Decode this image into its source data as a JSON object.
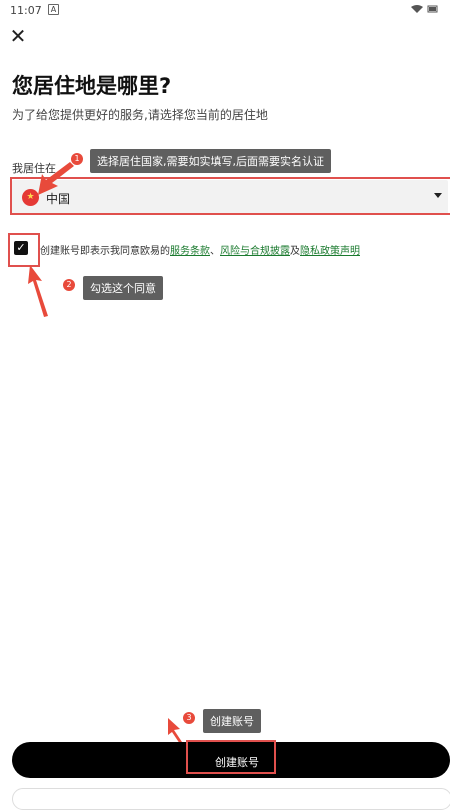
{
  "status_bar": {
    "time": "11:07",
    "sim_glyph": "A",
    "signal_icon": "wifi-icon",
    "battery_icon": "battery-icon"
  },
  "header": {
    "close_icon": "close-icon",
    "title": "您居住地是哪里?",
    "subtitle": "为了给您提供更好的服务,请选择您当前的居住地"
  },
  "form": {
    "country_label": "我居住在",
    "country_value": "中国",
    "flag_icon": "china-flag-icon",
    "agreement": {
      "checked": true,
      "prefix": "创建账号即表示我同意欧易的",
      "link1": "服务条款",
      "sep1": "、",
      "link2": "风险与合规披露",
      "sep2": "及",
      "link3": "隐私政策声明"
    },
    "create_button": "创建账号"
  },
  "annotations": {
    "tip1": {
      "number": "1",
      "text": "选择居住国家,需要如实填写,后面需要实名认证"
    },
    "tip2": {
      "number": "2",
      "text": "勾选这个同意"
    },
    "tip3": {
      "number": "3",
      "text": "创建账号"
    }
  },
  "colors": {
    "highlight": "#e0504d",
    "tooltip_bg": "#5f5f5f",
    "link": "#1a7a2e",
    "button": "#000000"
  }
}
